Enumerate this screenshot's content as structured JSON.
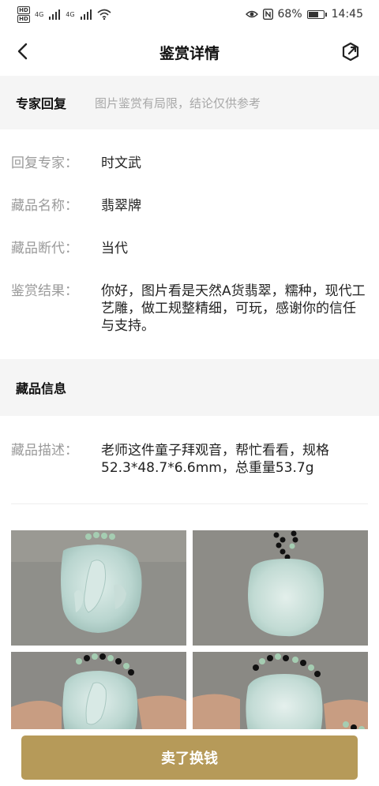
{
  "status_bar": {
    "hd_labels": [
      "HD",
      "HD"
    ],
    "network_1": "4G",
    "network_2": "4G",
    "battery_percent": "68%",
    "battery_level": 0.68,
    "time": "14:45",
    "icons": [
      "eye-icon",
      "nfc-icon",
      "battery-icon",
      "wifi-icon",
      "signal-icon"
    ]
  },
  "header": {
    "title": "鉴赏详情",
    "back_icon": "chevron-left-icon",
    "share_icon": "share-icon"
  },
  "expert_section": {
    "title": "专家回复",
    "note": "图片鉴赏有局限，结论仅供参考"
  },
  "expert_details": {
    "expert_label": "回复专家：",
    "expert_value": "时文武",
    "name_label": "藏品名称：",
    "name_value": "翡翠牌",
    "dating_label": "藏品断代：",
    "dating_value": "当代",
    "result_label": "鉴赏结果：",
    "result_value": "你好，图片看是天然A货翡翠，糯种，现代工艺雕，做工规整精细，可玩，感谢你的信任与支持。"
  },
  "item_section": {
    "title": "藏品信息",
    "desc_label": "藏品描述：",
    "desc_value": "老师这件童子拜观音，帮忙看看，规格52.3*48.7*6.6mm，总重量53.7g"
  },
  "photos": [
    "jade-front-photo",
    "jade-back-photo",
    "jade-front-hand-photo",
    "jade-back-hand-photo"
  ],
  "actions": {
    "sell_label": "卖了换钱"
  },
  "colors": {
    "accent": "#b69a59",
    "section_bg": "#f5f5f5",
    "label_gray": "#9a9a9a"
  }
}
